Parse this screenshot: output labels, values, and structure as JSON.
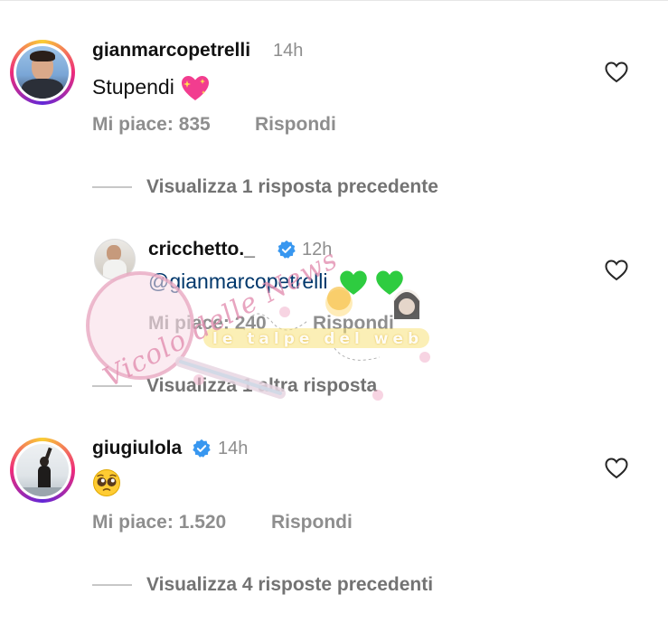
{
  "comments": [
    {
      "username": "gianmarcopetrelli",
      "time": "14h",
      "text": "Stupendi",
      "emoji": "sparkling-heart",
      "likes": "Mi piace: 835",
      "reply": "Rispondi",
      "thread": "Visualizza 1 risposta precedente"
    },
    {
      "username": "cricchetto._",
      "time": "12h",
      "mention": "@gianmarcopetrelli",
      "emoji": "green-hearts",
      "likes": "Mi piace: 240",
      "reply": "Rispondi",
      "thread": "Visualizza 1 altra risposta"
    },
    {
      "username": "giugiulola",
      "time": "14h",
      "emoji": "pleading-face",
      "likes": "Mi piace: 1.520",
      "reply": "Rispondi",
      "thread": "Visualizza 4 risposte precedenti"
    }
  ],
  "watermark": {
    "logo_text": "Vicolo delle News",
    "banner_text": "le talpe del web"
  },
  "colors": {
    "verified": "#3897f0",
    "mention": "#00376b",
    "secondary": "#8e8e8e",
    "heart_green": "#2ecc40"
  }
}
